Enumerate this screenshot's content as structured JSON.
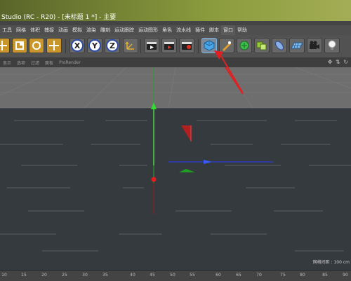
{
  "window": {
    "title": "Studio (RC - R20) - [未标题 1 *] - 主要"
  },
  "menu": {
    "items": [
      "工具",
      "网格",
      "体积",
      "捕捉",
      "动画",
      "模拟",
      "渲染",
      "雕刻",
      "运动跟踪",
      "运动图形",
      "角色",
      "流水线",
      "插件",
      "脚本",
      "窗口",
      "帮助"
    ],
    "active_index": 14
  },
  "toolbar": {
    "axis_x": "X",
    "axis_y": "Y",
    "axis_z": "Z",
    "icons": [
      "move-icon",
      "scale-icon",
      "rotate-icon",
      "live-selection-icon",
      "x-axis-icon",
      "y-axis-icon",
      "z-axis-icon",
      "coordinate-system-icon",
      "render-view-icon",
      "render-to-picture-viewer-icon",
      "render-settings-icon",
      "cube-icon",
      "pen-icon",
      "subdivision-icon",
      "array-icon",
      "deformer-icon",
      "floor-icon",
      "camera-icon",
      "light-icon"
    ],
    "colors": {
      "accent_axis": "#2b4aa8",
      "highlight": "#7ab4e0",
      "annotation": "#e02020"
    }
  },
  "viewport": {
    "menus": [
      "显示",
      "选项",
      "过滤",
      "面板",
      "ProRender"
    ],
    "grid_spacing_label": "网格间距 : 100 cm",
    "nav_icons": "✥ ⇅ ↻"
  },
  "timeline": {
    "ticks": [
      "10",
      "15",
      "20",
      "25",
      "30",
      "35",
      "40",
      "45",
      "50",
      "55",
      "60",
      "65",
      "70",
      "75",
      "80",
      "85",
      "90"
    ]
  }
}
